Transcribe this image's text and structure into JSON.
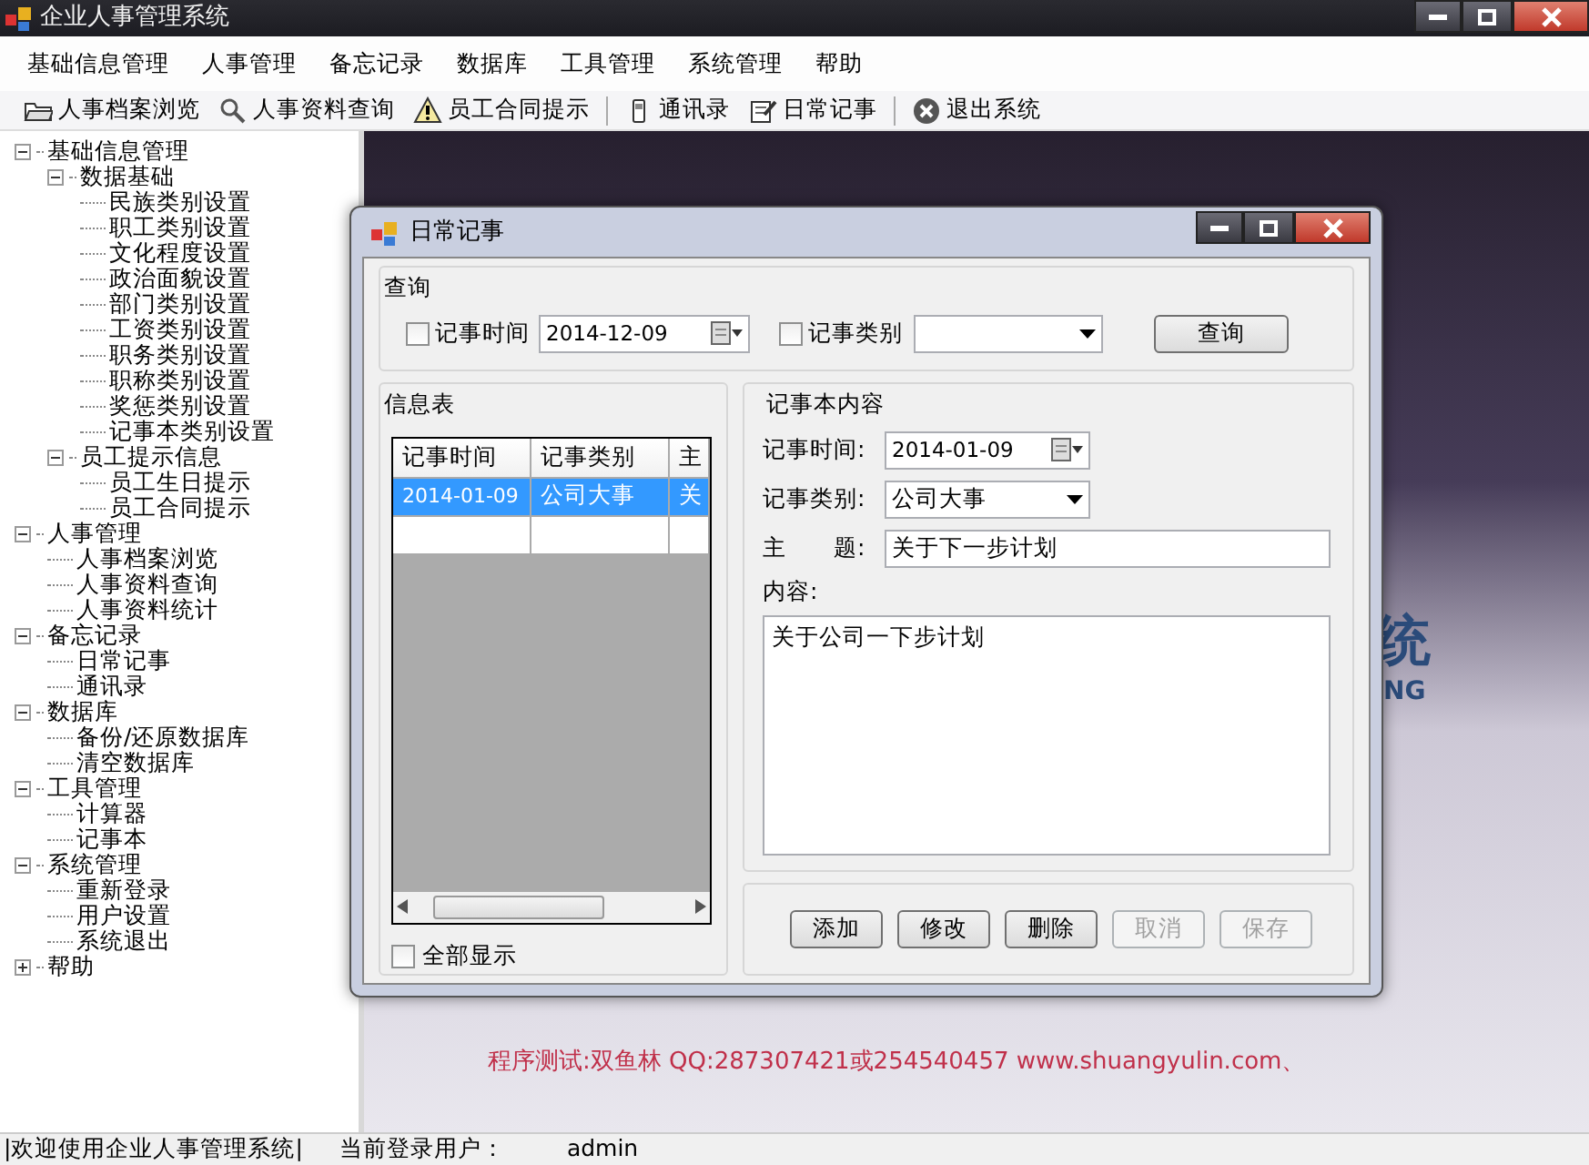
{
  "window": {
    "title": "企业人事管理系统"
  },
  "menu": [
    "基础信息管理",
    "人事管理",
    "备忘记录",
    "数据库",
    "工具管理",
    "系统管理",
    "帮助"
  ],
  "toolbar": [
    {
      "label": "人事档案浏览",
      "kind": "folder",
      "separator_before": false
    },
    {
      "label": "人事资料查询",
      "kind": "search",
      "separator_before": false
    },
    {
      "label": "员工合同提示",
      "kind": "warning",
      "separator_before": false
    },
    {
      "label": "通讯录",
      "kind": "phone",
      "separator_before": true
    },
    {
      "label": "日常记事",
      "kind": "note",
      "separator_before": false
    },
    {
      "label": "退出系统",
      "kind": "exit",
      "separator_before": true
    }
  ],
  "tree": [
    {
      "label": "基础信息管理",
      "expanded": true,
      "children": [
        {
          "label": "数据基础",
          "expanded": true,
          "children": [
            {
              "label": "民族类别设置"
            },
            {
              "label": "职工类别设置"
            },
            {
              "label": "文化程度设置"
            },
            {
              "label": "政治面貌设置"
            },
            {
              "label": "部门类别设置"
            },
            {
              "label": "工资类别设置"
            },
            {
              "label": "职务类别设置"
            },
            {
              "label": "职称类别设置"
            },
            {
              "label": "奖惩类别设置"
            },
            {
              "label": "记事本类别设置"
            }
          ]
        },
        {
          "label": "员工提示信息",
          "expanded": true,
          "children": [
            {
              "label": "员工生日提示"
            },
            {
              "label": "员工合同提示"
            }
          ]
        }
      ]
    },
    {
      "label": "人事管理",
      "expanded": true,
      "children": [
        {
          "label": "人事档案浏览"
        },
        {
          "label": "人事资料查询"
        },
        {
          "label": "人事资料统计"
        }
      ]
    },
    {
      "label": "备忘记录",
      "expanded": true,
      "children": [
        {
          "label": "日常记事"
        },
        {
          "label": "通讯录"
        }
      ]
    },
    {
      "label": "数据库",
      "expanded": true,
      "children": [
        {
          "label": "备份/还原数据库"
        },
        {
          "label": "清空数据库"
        }
      ]
    },
    {
      "label": "工具管理",
      "expanded": true,
      "children": [
        {
          "label": "计算器"
        },
        {
          "label": "记事本"
        }
      ]
    },
    {
      "label": "系统管理",
      "expanded": true,
      "children": [
        {
          "label": "重新登录"
        },
        {
          "label": "用户设置"
        },
        {
          "label": "系统退出"
        }
      ]
    },
    {
      "label": "帮助",
      "expanded": false
    }
  ],
  "background": {
    "fragments": [
      "统",
      "NG"
    ],
    "banner": "程序测试:双鱼林 QQ:287307421或254540457 www.shuangyulin.com、"
  },
  "dialog": {
    "title": "日常记事",
    "query": {
      "title": "查询",
      "date_filter": {
        "label": "记事时间",
        "checked": false,
        "value": "2014-12-09"
      },
      "type_filter": {
        "label": "记事类别",
        "checked": false
      },
      "button": "查询"
    },
    "list": {
      "title": "信息表",
      "columns": [
        "记事时间",
        "记事类别",
        "主"
      ],
      "rows": [
        {
          "cells": [
            "2014-01-09",
            "公司大事",
            "关"
          ],
          "selected": true
        }
      ],
      "show_all": {
        "label": "全部显示",
        "checked": false
      }
    },
    "detail": {
      "title": "记事本内容",
      "fields": [
        {
          "label": "记事时间:",
          "kind": "date",
          "value": "2014-01-09"
        },
        {
          "label": "记事类别:",
          "kind": "combo",
          "value": "公司大事"
        },
        {
          "label": "主　　题:",
          "kind": "text",
          "value": "关于下一步计划"
        }
      ],
      "content_label": "内容:",
      "content": "关于公司一下步计划"
    },
    "buttons": [
      {
        "label": "添加",
        "disabled": false
      },
      {
        "label": "修改",
        "disabled": false
      },
      {
        "label": "删除",
        "disabled": false
      },
      {
        "label": "取消",
        "disabled": true
      },
      {
        "label": "保存",
        "disabled": true
      }
    ]
  },
  "status_bar": [
    "|欢迎使用企业人事管理系统|",
    "当前登录用户：",
    "admin"
  ]
}
